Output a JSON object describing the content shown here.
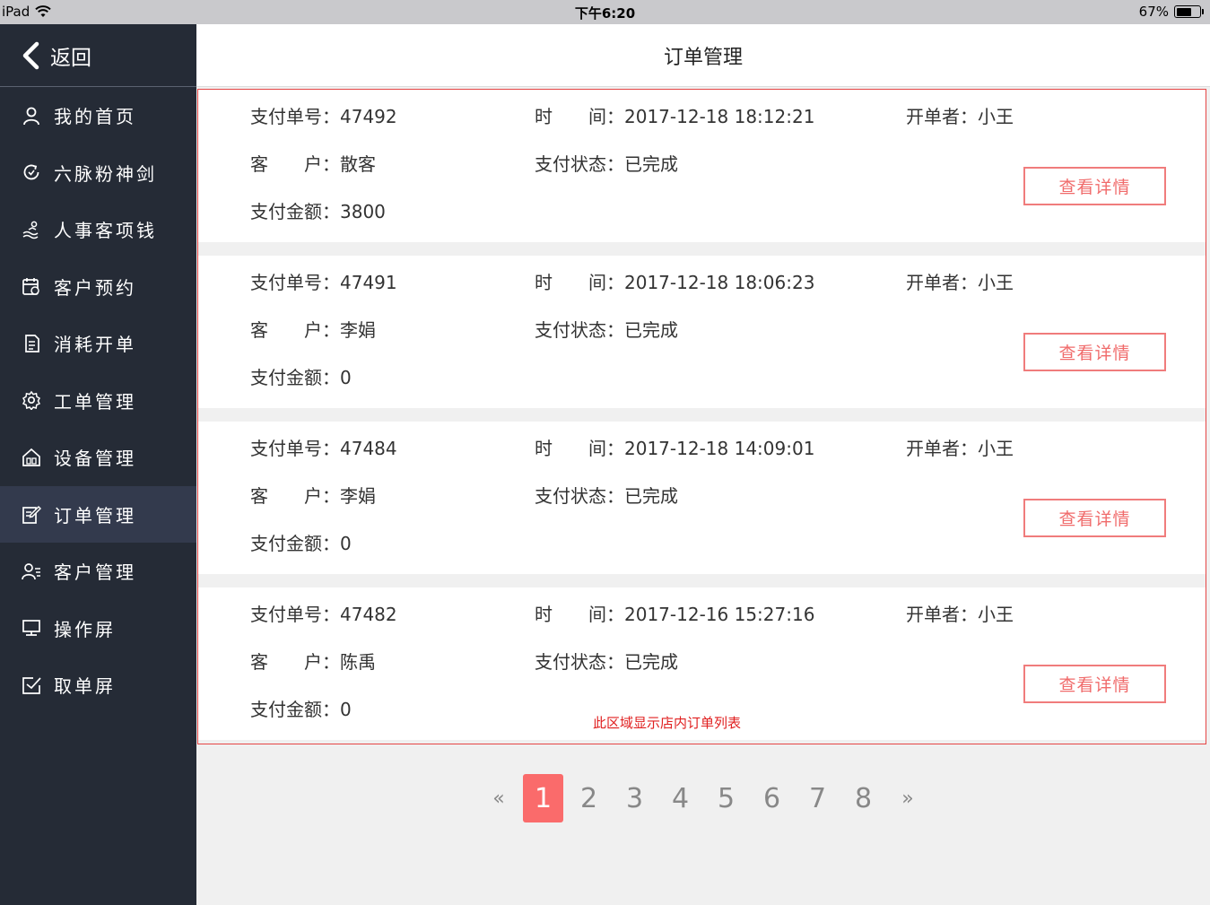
{
  "status_bar": {
    "device": "iPad",
    "time": "下午6:20",
    "battery": "67%",
    "battery_level": 0.67
  },
  "sidebar": {
    "back_label": "返回",
    "items": [
      {
        "label": "我的首页",
        "icon": "user-icon"
      },
      {
        "label": "六脉粉神剑",
        "icon": "refresh-icon"
      },
      {
        "label": "人事客项钱",
        "icon": "people-icon"
      },
      {
        "label": "客户预约",
        "icon": "calendar-icon"
      },
      {
        "label": "消耗开单",
        "icon": "document-icon"
      },
      {
        "label": "工单管理",
        "icon": "gear-icon"
      },
      {
        "label": "设备管理",
        "icon": "home-icon"
      },
      {
        "label": "订单管理",
        "icon": "edit-icon",
        "active": true
      },
      {
        "label": "客户管理",
        "icon": "user-list-icon"
      },
      {
        "label": "操作屏",
        "icon": "monitor-icon"
      },
      {
        "label": "取单屏",
        "icon": "checkbox-icon"
      }
    ]
  },
  "header": {
    "title": "订单管理"
  },
  "labels": {
    "order_no": "支付单号：",
    "time": "时　　间：",
    "operator": "开单者：",
    "customer": "客　　户：",
    "pay_status": "支付状态：",
    "amount": "支付金额：",
    "detail_button": "查看详情"
  },
  "orders": [
    {
      "order_no": "47492",
      "time": "2017-12-18 18:12:21",
      "operator": "小王",
      "customer": "散客",
      "status": "已完成",
      "amount": "3800"
    },
    {
      "order_no": "47491",
      "time": "2017-12-18 18:06:23",
      "operator": "小王",
      "customer": "李娟",
      "status": "已完成",
      "amount": "0"
    },
    {
      "order_no": "47484",
      "time": "2017-12-18 14:09:01",
      "operator": "小王",
      "customer": "李娟",
      "status": "已完成",
      "amount": "0"
    },
    {
      "order_no": "47482",
      "time": "2017-12-16 15:27:16",
      "operator": "小王",
      "customer": "陈禹",
      "status": "已完成",
      "amount": "0"
    }
  ],
  "annotation": "此区域显示店内订单列表",
  "pagination": {
    "prev": "«",
    "next": "»",
    "pages": [
      "1",
      "2",
      "3",
      "4",
      "5",
      "6",
      "7",
      "8"
    ],
    "current": "1"
  },
  "colors": {
    "sidebar_bg": "#252b36",
    "sidebar_active": "#333a4d",
    "accent": "#fa6b6b",
    "annotation": "#e02020"
  }
}
